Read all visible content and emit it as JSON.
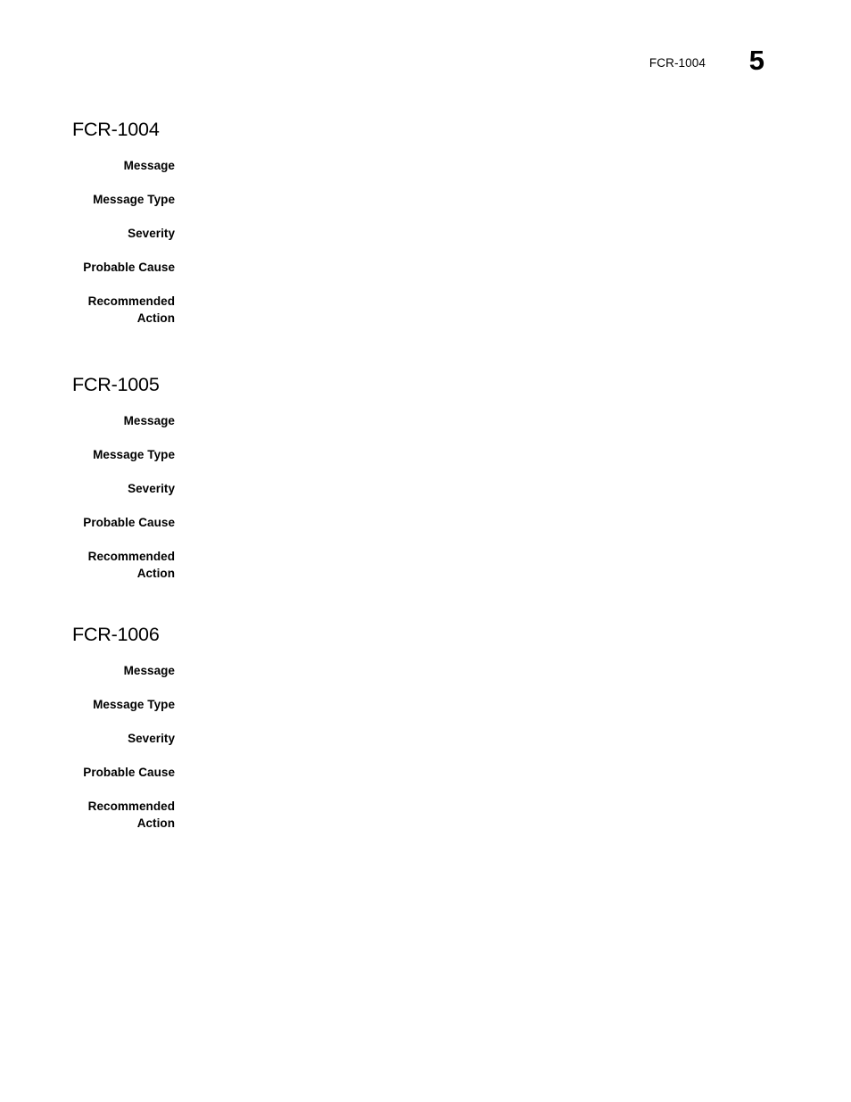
{
  "header": {
    "chapter_ref": "FCR-1004",
    "page_number": "5"
  },
  "sections": [
    {
      "heading": "FCR-1004",
      "fields": [
        {
          "label": "Message",
          "value": ""
        },
        {
          "label": "Message Type",
          "value": ""
        },
        {
          "label": "Severity",
          "value": ""
        },
        {
          "label": "Probable Cause",
          "value": ""
        },
        {
          "label": "Recommended Action",
          "value": ""
        }
      ]
    },
    {
      "heading": "FCR-1005",
      "fields": [
        {
          "label": "Message",
          "value": ""
        },
        {
          "label": "Message Type",
          "value": ""
        },
        {
          "label": "Severity",
          "value": ""
        },
        {
          "label": "Probable Cause",
          "value": ""
        },
        {
          "label": "Recommended Action",
          "value": ""
        }
      ]
    },
    {
      "heading": "FCR-1006",
      "fields": [
        {
          "label": "Message",
          "value": ""
        },
        {
          "label": "Message Type",
          "value": ""
        },
        {
          "label": "Severity",
          "value": ""
        },
        {
          "label": "Probable Cause",
          "value": ""
        },
        {
          "label": "Recommended Action",
          "value": ""
        }
      ]
    }
  ]
}
